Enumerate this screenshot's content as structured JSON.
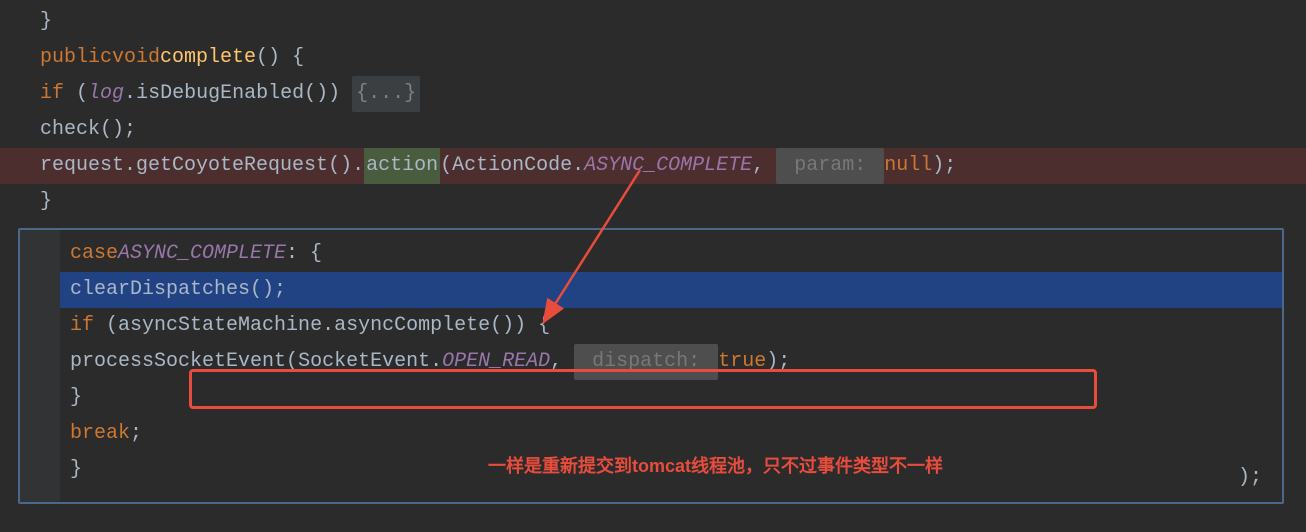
{
  "upper": {
    "line0_brace": "}",
    "line1": {
      "kw_public": "public",
      "kw_void": "void",
      "method": "complete",
      "parens": "()",
      "brace": " {"
    },
    "line2": {
      "kw_if": "if",
      "open": " (",
      "var": "log",
      "dot": ".",
      "method": "isDebugEnabled",
      "close": "()) ",
      "fold": "{...}"
    },
    "line3": {
      "method": "check",
      "parens": "();"
    },
    "line4": {
      "var": "request",
      "dot1": ".",
      "m1": "getCoyoteRequest",
      "p1": "().",
      "m2": "action",
      "open": "(",
      "cls": "ActionCode",
      "dot2": ".",
      "enum": "ASYNC_COMPLETE",
      "comma": ", ",
      "hint": " param: ",
      "nullkw": "null",
      "close": ");"
    },
    "line5_brace": "}"
  },
  "popup": {
    "line1": {
      "kw_case": "case",
      "enum": "ASYNC_COMPLETE",
      "colon": ": {"
    },
    "line2": {
      "method": "clearDispatches",
      "close": "();"
    },
    "line3": {
      "kw_if": "if",
      "open": " (",
      "var": "asyncStateMachine",
      "dot": ".",
      "method": "asyncComplete",
      "close": "()) {"
    },
    "line4": {
      "method": "processSocketEvent",
      "open": "(",
      "cls": "SocketEvent",
      "dot": ".",
      "enum": "OPEN_READ",
      "comma": ", ",
      "hint": " dispatch: ",
      "bool": "true",
      "close": ");"
    },
    "line5_brace": "}",
    "line6_break": "break",
    "line6_semi": ";",
    "line7_brace": "}"
  },
  "annotation": "一样是重新提交到tomcat线程池，只不过事件类型不一样",
  "tail": ");"
}
